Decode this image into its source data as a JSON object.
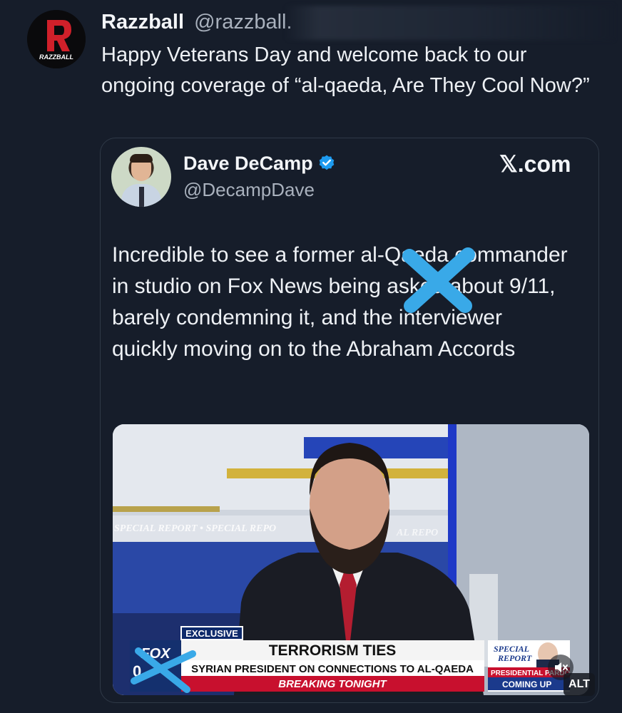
{
  "post": {
    "display_name": "Razzball",
    "handle": "@razzball.",
    "text": "Happy Veterans Day and welcome back to our ongoing coverage of “al-qaeda, Are They Cool Now?”",
    "avatar_label": "RAZZBALL"
  },
  "quote": {
    "display_name": "Dave DeCamp",
    "handle": "@DecampDave",
    "source_label": "𝕏.com",
    "text": "Incredible to see a former al-Qaeda commander in studio on Fox News being asked about 9/11, barely condemning it, and the interviewer quickly moving on to the Abraham Accords"
  },
  "media": {
    "tag": "EXCLUSIVE",
    "headline": "TERRORISM TIES",
    "subline": "SYRIAN PRESIDENT ON CONNECTIONS TO AL-QAEDA",
    "breaking": "BREAKING TONIGHT",
    "network": "FOX",
    "network_prefix": "0",
    "promo_line1": "SPECIAL",
    "promo_line2": "REPORT",
    "promo_line3": "PRESIDENTIAL PARDO",
    "promo_line4": "COMING UP",
    "backdrop_text": "SPECIAL REPORT • SPECIAL REPO",
    "backdrop_text2": "AL REPO",
    "alt_label": "ALT"
  },
  "colors": {
    "background": "#161d2a",
    "verified": "#1d9bf0",
    "x_mark": "#39a9e8",
    "fox_blue": "#1b3a8c",
    "breaking_red": "#c8102e"
  },
  "icons": {
    "verified": "verified-badge-icon",
    "mute": "speaker-mute-icon"
  }
}
